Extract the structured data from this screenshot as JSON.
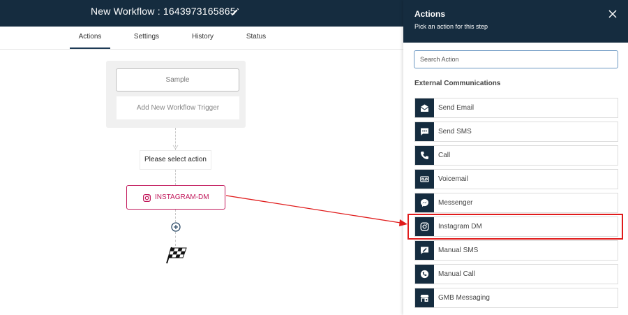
{
  "header": {
    "title": "New Workflow : 1643973165865"
  },
  "tabs": [
    {
      "label": "Actions",
      "active": true
    },
    {
      "label": "Settings",
      "active": false
    },
    {
      "label": "History",
      "active": false
    },
    {
      "label": "Status",
      "active": false
    }
  ],
  "canvas": {
    "trigger_box": {
      "sample_label": "Sample",
      "add_trigger_label": "Add New Workflow Trigger"
    },
    "select_action_label": "Please select action",
    "action_node": {
      "label": "INSTAGRAM-DM",
      "icon": "instagram-icon"
    }
  },
  "panel": {
    "title": "Actions",
    "subtitle": "Pick an action for this step",
    "search_placeholder": "Search Action",
    "section_title": "External Communications",
    "items": [
      {
        "label": "Send Email",
        "icon": "email-icon"
      },
      {
        "label": "Send SMS",
        "icon": "sms-icon"
      },
      {
        "label": "Call",
        "icon": "phone-icon"
      },
      {
        "label": "Voicemail",
        "icon": "voicemail-icon"
      },
      {
        "label": "Messenger",
        "icon": "messenger-icon"
      },
      {
        "label": "Instagram DM",
        "icon": "instagram-icon",
        "highlighted": true
      },
      {
        "label": "Manual SMS",
        "icon": "manual-sms-icon"
      },
      {
        "label": "Manual Call",
        "icon": "manual-call-icon"
      },
      {
        "label": "GMB Messaging",
        "icon": "gmb-icon"
      }
    ]
  },
  "colors": {
    "header_bg": "#152c3f",
    "accent_instagram": "#c2185b",
    "annotation_red": "#e01b1b",
    "search_border": "#6a97c2"
  }
}
